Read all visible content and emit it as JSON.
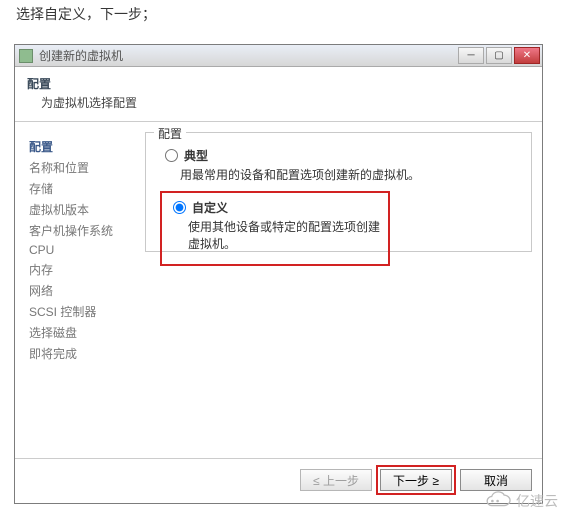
{
  "caption": "选择自定义，下一步；",
  "titlebar": {
    "title": "创建新的虚拟机"
  },
  "header": {
    "title": "配置",
    "subtitle": "为虚拟机选择配置"
  },
  "sidebar": {
    "steps": [
      {
        "label": "配置",
        "current": true
      },
      {
        "label": "名称和位置"
      },
      {
        "label": "存储"
      },
      {
        "label": "虚拟机版本"
      },
      {
        "label": "客户机操作系统"
      },
      {
        "label": "CPU"
      },
      {
        "label": "内存"
      },
      {
        "label": "网络"
      },
      {
        "label": "SCSI 控制器"
      },
      {
        "label": "选择磁盘"
      },
      {
        "label": "即将完成"
      }
    ]
  },
  "fieldset": {
    "legend": "配置",
    "typical": {
      "label": "典型",
      "desc": "用最常用的设备和配置选项创建新的虚拟机。"
    },
    "custom": {
      "label": "自定义",
      "desc": "使用其他设备或特定的配置选项创建虚拟机。"
    },
    "selected": "custom"
  },
  "footer": {
    "back": "≤ 上一步",
    "next": "下一步 ≥",
    "cancel": "取消"
  },
  "watermark": "亿速云"
}
